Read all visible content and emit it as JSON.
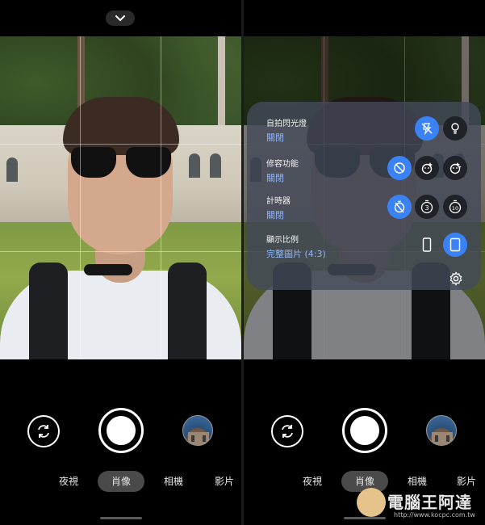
{
  "left_screen": {
    "modes": [
      {
        "label": "夜視",
        "active": false
      },
      {
        "label": "肖像",
        "active": true
      },
      {
        "label": "相機",
        "active": false
      },
      {
        "label": "影片",
        "active": false
      }
    ],
    "icons": {
      "collapse": "chevron-down-icon",
      "switch": "switch-camera-icon",
      "shutter": "shutter-icon",
      "thumbnail": "gallery-thumbnail-icon"
    }
  },
  "right_screen": {
    "settings_panel": {
      "rows": [
        {
          "title": "自拍閃光燈",
          "value": "關閉",
          "options": [
            {
              "icon": "flash-off-icon",
              "active": true
            },
            {
              "icon": "flash-on-icon",
              "active": false
            }
          ]
        },
        {
          "title": "修容功能",
          "value": "關閉",
          "options": [
            {
              "icon": "retouch-off-icon",
              "active": true
            },
            {
              "icon": "retouch-soft-icon",
              "active": false
            },
            {
              "icon": "retouch-natural-icon",
              "active": false
            }
          ]
        },
        {
          "title": "計時器",
          "value": "關閉",
          "options": [
            {
              "icon": "timer-off-icon",
              "active": true
            },
            {
              "icon": "timer-3s-icon",
              "label": "3",
              "active": false
            },
            {
              "icon": "timer-10s-icon",
              "label": "10",
              "active": false
            }
          ]
        },
        {
          "title": "顯示比例",
          "value": "完整圖片 (4:3)",
          "options": [
            {
              "icon": "ratio-tall-icon",
              "active": false
            },
            {
              "icon": "ratio-full-icon",
              "active": true
            }
          ]
        }
      ],
      "settings_icon": "gear-icon"
    },
    "modes": [
      {
        "label": "夜視",
        "active": false
      },
      {
        "label": "肖像",
        "active": true
      },
      {
        "label": "相機",
        "active": false
      },
      {
        "label": "影片",
        "active": false
      }
    ]
  },
  "watermark": {
    "text": "電腦王阿達",
    "url": "http://www.kocpc.com.tw"
  },
  "colors": {
    "accent": "#3b82f6",
    "value_text": "#8fb7ff",
    "panel_bg": "#444a5a"
  }
}
